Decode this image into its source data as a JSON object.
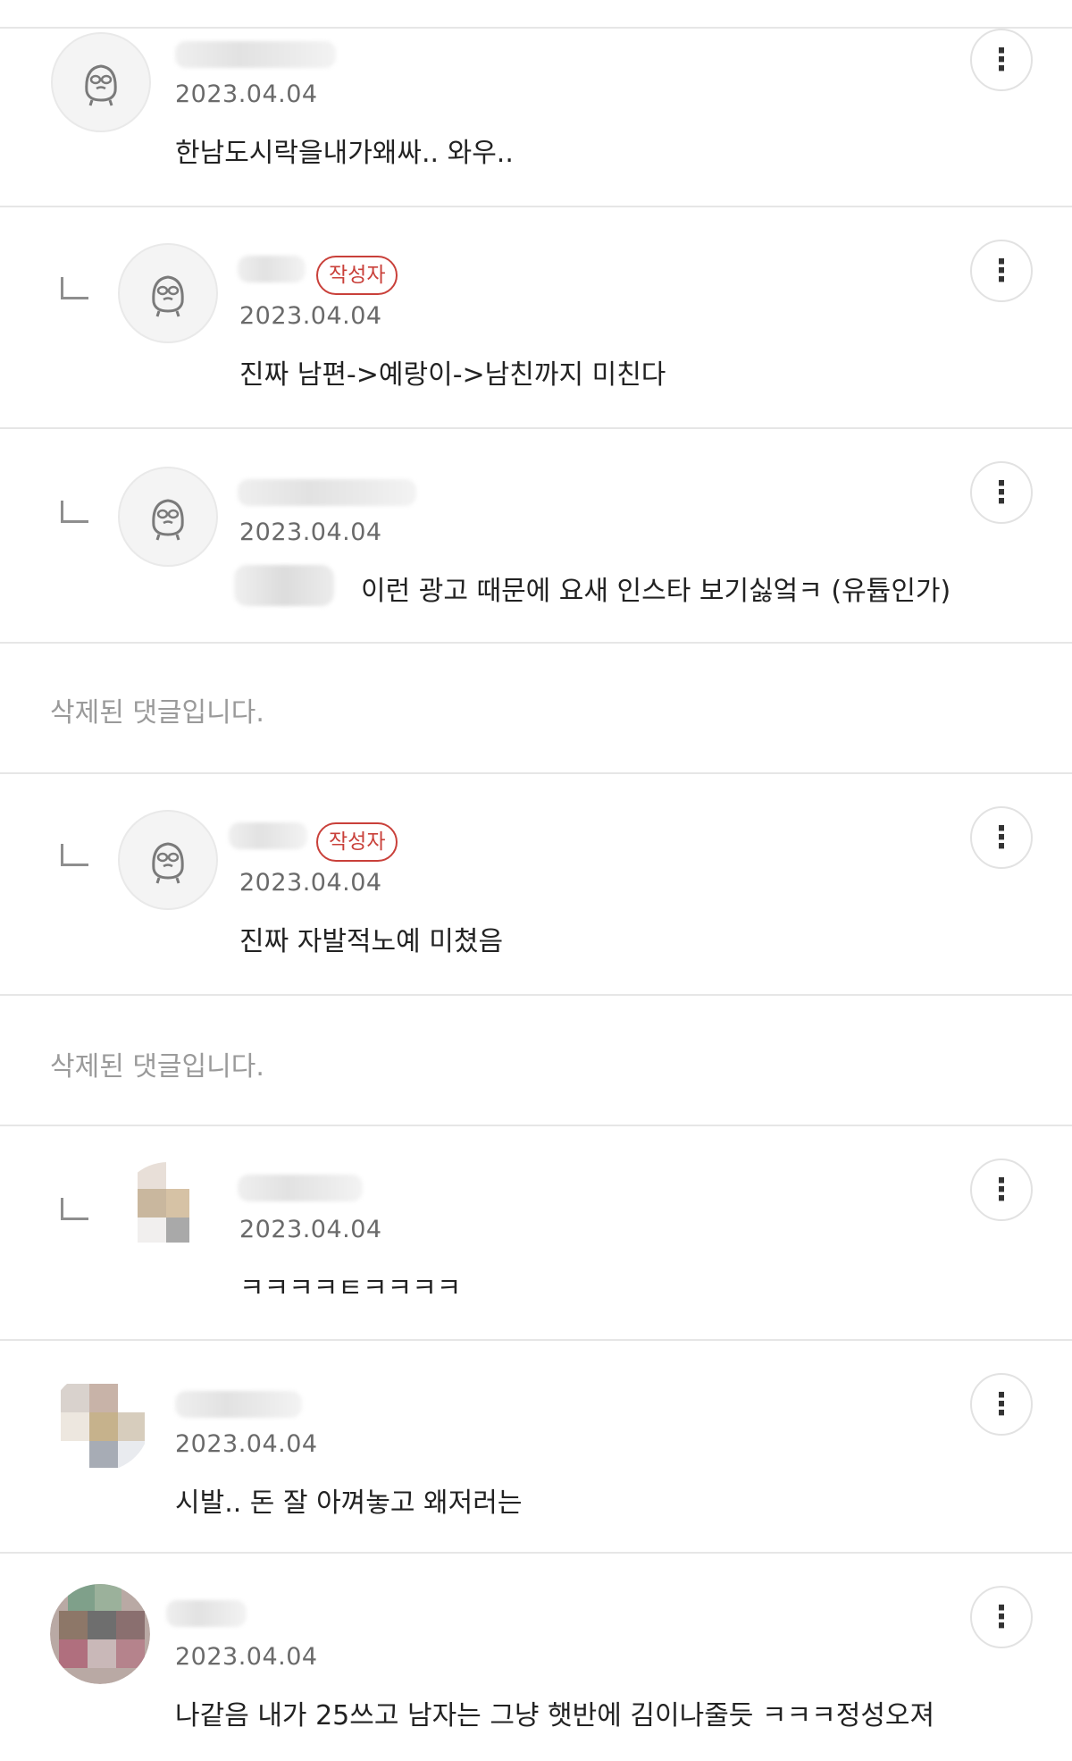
{
  "comments": [
    {
      "date": "2023.04.04",
      "text": "한남도시락을내가왜싸.. 와우..",
      "more_icon": "⋮"
    },
    {
      "badge": "작성자",
      "date": "2023.04.04",
      "text": "진짜 남편->예랑이->남친까지 미친다",
      "more_icon": "⋮"
    },
    {
      "date": "2023.04.04",
      "text": "이런 광고 때문에 요새 인스타 보기싫엌ㅋ (유튭인가)",
      "more_icon": "⋮"
    },
    {
      "deleted": "삭제된 댓글입니다."
    },
    {
      "badge": "작성자",
      "date": "2023.04.04",
      "text": "진짜 자발적노예 미쳤음",
      "more_icon": "⋮"
    },
    {
      "deleted": "삭제된 댓글입니다."
    },
    {
      "date": "2023.04.04",
      "text": "ㅋㅋㅋㅋㅌㅋㅋㅋㅋ",
      "more_icon": "⋮"
    },
    {
      "date": "2023.04.04",
      "text": "시발.. 돈 잘 아껴놓고 왜저러는",
      "more_icon": "⋮"
    },
    {
      "date": "2023.04.04",
      "text": "나같음 내가 25쓰고 남자는 그냥 햇반에 김이나줄듯 ㅋㅋㅋ정성오져",
      "more_icon": "⋮"
    }
  ],
  "icons": {
    "default_avatar": "ghost-character-avatar-icon",
    "reply": "reply-arrow-icon",
    "more": "more-vertical-icon"
  }
}
